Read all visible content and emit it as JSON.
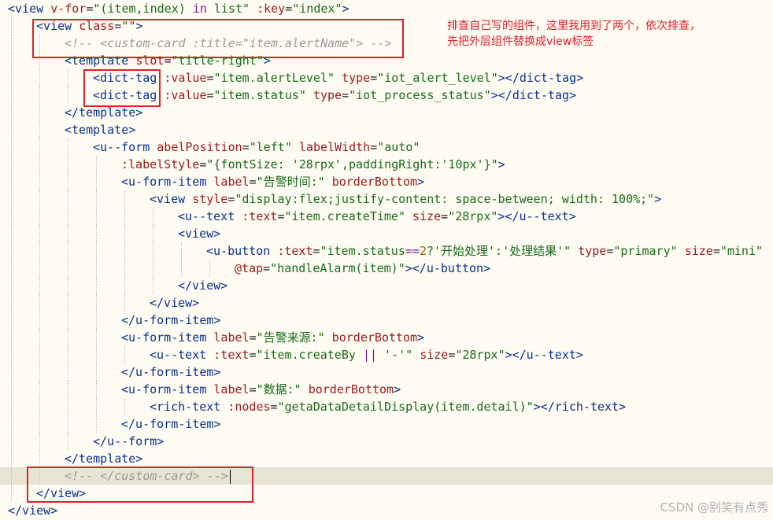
{
  "editor": {
    "lines": [
      {
        "indent": 0,
        "tokens": [
          [
            "tag",
            "<view "
          ],
          [
            "attr",
            "v-for"
          ],
          [
            "pun",
            "="
          ],
          [
            "str",
            "\"(item,index) "
          ],
          [
            "kw",
            "in"
          ],
          [
            "str",
            " list\""
          ],
          [
            "txt",
            " "
          ],
          [
            "attr",
            ":key"
          ],
          [
            "pun",
            "="
          ],
          [
            "str",
            "\"index\""
          ],
          [
            "tag",
            ">"
          ]
        ]
      },
      {
        "indent": 1,
        "tokens": [
          [
            "tag",
            "<view "
          ],
          [
            "attr",
            "class"
          ],
          [
            "pun",
            "="
          ],
          [
            "str",
            "\"\""
          ],
          [
            "tag",
            ">"
          ]
        ]
      },
      {
        "indent": 2,
        "tokens": [
          [
            "com",
            "<!-- <custom-card :title=\"item.alertName\"> -->"
          ]
        ]
      },
      {
        "indent": 2,
        "tokens": [
          [
            "tag",
            "<template "
          ],
          [
            "attr",
            "slot"
          ],
          [
            "pun",
            "="
          ],
          [
            "str",
            "\"title-right\""
          ],
          [
            "tag",
            ">"
          ]
        ]
      },
      {
        "indent": 3,
        "tokens": [
          [
            "tag",
            "<dict-tag "
          ],
          [
            "attr",
            ":value"
          ],
          [
            "pun",
            "="
          ],
          [
            "str",
            "\"item.alertLevel\""
          ],
          [
            "txt",
            " "
          ],
          [
            "attr",
            "type"
          ],
          [
            "pun",
            "="
          ],
          [
            "str",
            "\"iot_alert_level\""
          ],
          [
            "tag",
            "></dict-tag>"
          ]
        ]
      },
      {
        "indent": 3,
        "tokens": [
          [
            "tag",
            "<dict-tag "
          ],
          [
            "attr",
            ":value"
          ],
          [
            "pun",
            "="
          ],
          [
            "str",
            "\"item.status\""
          ],
          [
            "txt",
            " "
          ],
          [
            "attr",
            "type"
          ],
          [
            "pun",
            "="
          ],
          [
            "str",
            "\"iot_process_status\""
          ],
          [
            "tag",
            "></dict-tag>"
          ]
        ]
      },
      {
        "indent": 2,
        "tokens": [
          [
            "tag",
            "</template>"
          ]
        ]
      },
      {
        "indent": 2,
        "tokens": [
          [
            "tag",
            "<template>"
          ]
        ]
      },
      {
        "indent": 3,
        "tokens": [
          [
            "tag",
            "<u--form "
          ],
          [
            "attr",
            "abelPosition"
          ],
          [
            "pun",
            "="
          ],
          [
            "str",
            "\"left\""
          ],
          [
            "txt",
            " "
          ],
          [
            "attr",
            "labelWidth"
          ],
          [
            "pun",
            "="
          ],
          [
            "str",
            "\"auto\""
          ]
        ]
      },
      {
        "indent": 4,
        "tokens": [
          [
            "attr",
            ":labelStyle"
          ],
          [
            "pun",
            "="
          ],
          [
            "str",
            "\"{fontSize: '28rpx',paddingRight:'10px'}\""
          ],
          [
            "tag",
            ">"
          ]
        ]
      },
      {
        "indent": 4,
        "tokens": [
          [
            "tag",
            "<u-form-item "
          ],
          [
            "attr",
            "label"
          ],
          [
            "pun",
            "="
          ],
          [
            "str",
            "\"告警时间:\""
          ],
          [
            "txt",
            " "
          ],
          [
            "attr",
            "borderBottom"
          ],
          [
            "tag",
            ">"
          ]
        ]
      },
      {
        "indent": 5,
        "tokens": [
          [
            "tag",
            "<view "
          ],
          [
            "attr",
            "style"
          ],
          [
            "pun",
            "="
          ],
          [
            "str",
            "\"display:flex;justify-content: space-between; width: 100%;\""
          ],
          [
            "tag",
            ">"
          ]
        ]
      },
      {
        "indent": 6,
        "tokens": [
          [
            "tag",
            "<u--text "
          ],
          [
            "attr",
            ":text"
          ],
          [
            "pun",
            "="
          ],
          [
            "str",
            "\"item.createTime\""
          ],
          [
            "txt",
            " "
          ],
          [
            "attr",
            "size"
          ],
          [
            "pun",
            "="
          ],
          [
            "str",
            "\"28rpx\""
          ],
          [
            "tag",
            "></u--text>"
          ]
        ]
      },
      {
        "indent": 6,
        "tokens": [
          [
            "tag",
            "<view>"
          ]
        ]
      },
      {
        "indent": 7,
        "tokens": [
          [
            "tag",
            "<u-button "
          ],
          [
            "attr",
            ":text"
          ],
          [
            "pun",
            "="
          ],
          [
            "str",
            "\"item.status"
          ],
          [
            "kw",
            "=="
          ],
          [
            "num",
            "2"
          ],
          [
            "str",
            "?'开始处理':'处理结果'\""
          ],
          [
            "txt",
            " "
          ],
          [
            "attr",
            "type"
          ],
          [
            "pun",
            "="
          ],
          [
            "str",
            "\"primary\""
          ],
          [
            "txt",
            " "
          ],
          [
            "attr",
            "size"
          ],
          [
            "pun",
            "="
          ],
          [
            "str",
            "\"mini\""
          ]
        ]
      },
      {
        "indent": 8,
        "tokens": [
          [
            "attr",
            "@tap"
          ],
          [
            "pun",
            "="
          ],
          [
            "str",
            "\"handleAlarm(item)\""
          ],
          [
            "tag",
            "></u-button>"
          ]
        ]
      },
      {
        "indent": 6,
        "tokens": [
          [
            "tag",
            "</view>"
          ]
        ]
      },
      {
        "indent": 5,
        "tokens": [
          [
            "tag",
            "</view>"
          ]
        ]
      },
      {
        "indent": 4,
        "tokens": [
          [
            "tag",
            "</u-form-item>"
          ]
        ]
      },
      {
        "indent": 4,
        "tokens": [
          [
            "tag",
            "<u-form-item "
          ],
          [
            "attr",
            "label"
          ],
          [
            "pun",
            "="
          ],
          [
            "str",
            "\"告警来源:\""
          ],
          [
            "txt",
            " "
          ],
          [
            "attr",
            "borderBottom"
          ],
          [
            "tag",
            ">"
          ]
        ]
      },
      {
        "indent": 5,
        "tokens": [
          [
            "tag",
            "<u--text "
          ],
          [
            "attr",
            ":text"
          ],
          [
            "pun",
            "="
          ],
          [
            "str",
            "\"item.createBy "
          ],
          [
            "kw",
            "||"
          ],
          [
            "str",
            " '-'\""
          ],
          [
            "txt",
            " "
          ],
          [
            "attr",
            "size"
          ],
          [
            "pun",
            "="
          ],
          [
            "str",
            "\"28rpx\""
          ],
          [
            "tag",
            "></u--text>"
          ]
        ]
      },
      {
        "indent": 4,
        "tokens": [
          [
            "tag",
            "</u-form-item>"
          ]
        ]
      },
      {
        "indent": 4,
        "tokens": [
          [
            "tag",
            "<u-form-item "
          ],
          [
            "attr",
            "label"
          ],
          [
            "pun",
            "="
          ],
          [
            "str",
            "\"数据:\""
          ],
          [
            "txt",
            " "
          ],
          [
            "attr",
            "borderBottom"
          ],
          [
            "tag",
            ">"
          ]
        ]
      },
      {
        "indent": 5,
        "tokens": [
          [
            "tag",
            "<rich-text "
          ],
          [
            "attr",
            ":nodes"
          ],
          [
            "pun",
            "="
          ],
          [
            "str",
            "\"getaDataDetailDisplay(item.detail)\""
          ],
          [
            "tag",
            "></rich-text>"
          ]
        ]
      },
      {
        "indent": 4,
        "tokens": [
          [
            "tag",
            "</u-form-item>"
          ]
        ]
      },
      {
        "indent": 3,
        "tokens": [
          [
            "tag",
            "</u--form>"
          ]
        ]
      },
      {
        "indent": 2,
        "tokens": [
          [
            "tag",
            "</template>"
          ]
        ]
      },
      {
        "indent": 2,
        "current": true,
        "caret": true,
        "tokens": [
          [
            "com",
            "<!-- </custom-card> -->"
          ]
        ]
      },
      {
        "indent": 1,
        "tokens": [
          [
            "tag",
            "</view>"
          ]
        ]
      },
      {
        "indent": 0,
        "tokens": [
          [
            "tag",
            "</view>"
          ]
        ]
      }
    ]
  },
  "annotation": {
    "line1": "排查自己写的组件，这里我用到了两个，依次排查，",
    "line2": "先把外层组件替换成view标签"
  },
  "watermark": "CSDN @别笑有点秀",
  "colors": {
    "annotation": "#e0202b",
    "highlight_box": "#e0202b",
    "background": "#fdfbf2"
  }
}
